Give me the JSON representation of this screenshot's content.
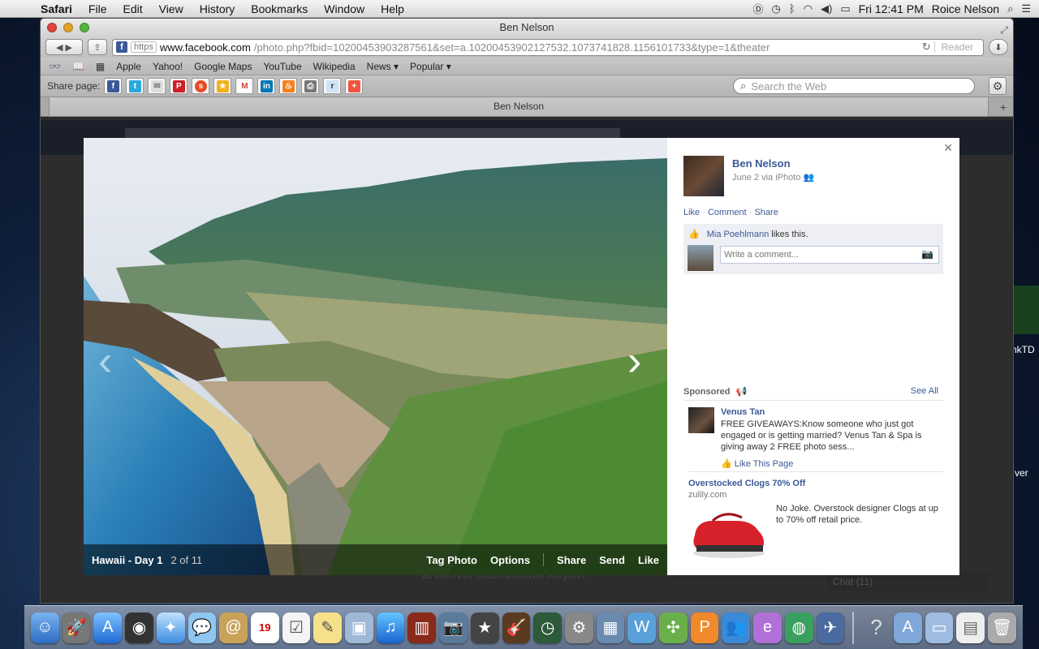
{
  "menubar": {
    "app": "Safari",
    "items": [
      "File",
      "Edit",
      "View",
      "History",
      "Bookmarks",
      "Window",
      "Help"
    ],
    "clock": "Fri 12:41 PM",
    "user": "Roice Nelson"
  },
  "window": {
    "title": "Ben Nelson",
    "https": "https",
    "url_host": "www.facebook.com",
    "url_path": "/photo.php?fbid=10200453903287561&set=a.10200453902127532.1073741828.1156101733&type=1&theater",
    "reader": "Reader",
    "bookmarks": [
      "Apple",
      "Yahoo!",
      "Google Maps",
      "YouTube",
      "Wikipedia",
      "News ▾",
      "Popular ▾"
    ],
    "share_label": "Share page:",
    "search_placeholder": "Search the Web",
    "tab_title": "Ben Nelson"
  },
  "background_page": {
    "location_text": "a. Denver International Airport",
    "chat": "Chat (11)"
  },
  "photo": {
    "album": "Hawaii - Day 1",
    "count": "2 of 11",
    "actions": {
      "tag": "Tag Photo",
      "options": "Options",
      "share": "Share",
      "send": "Send",
      "like": "Like"
    }
  },
  "post": {
    "owner": "Ben Nelson",
    "meta": "June 2 via iPhoto",
    "like": "Like",
    "comment": "Comment",
    "share": "Share",
    "liker": "Mia Poehlmann",
    "likes_suffix": "likes this.",
    "comment_placeholder": "Write a comment..."
  },
  "sponsored": {
    "label": "Sponsored",
    "see_all": "See All",
    "ad1": {
      "title": "Venus Tan",
      "body": "FREE GIVEAWAYS:Know someone who just got engaged or is getting married? Venus Tan & Spa is giving away 2 FREE photo sess...",
      "like_page": "Like This Page"
    },
    "ad2": {
      "title": "Overstocked Clogs 70% Off",
      "domain": "zulily.com",
      "body": "No Joke. Overstock designer Clogs at up to 70% off retail price."
    }
  },
  "desktop": {
    "label1": "nkTD",
    "label2": "ver"
  },
  "dock_calendar_day": "19"
}
